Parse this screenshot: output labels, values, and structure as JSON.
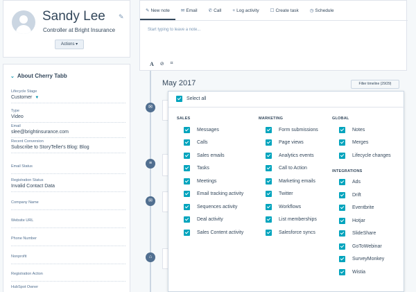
{
  "profile": {
    "name": "Sandy Lee",
    "title": "Controller at Bright Insurance",
    "actions_label": "Actions"
  },
  "about": {
    "header": "About Cherry Tabb",
    "properties": [
      {
        "label": "Lifecycle Stage",
        "value": "Customer",
        "dropdown": true
      },
      {
        "label": "Type",
        "value": "Video"
      },
      {
        "label": "Email",
        "value": "slee@brightinsurance.com"
      },
      {
        "label": "Recent Conversion",
        "value": "Subscribe to StoryTeller's Blog: Blog"
      },
      {
        "label": "Email Status",
        "value": ""
      },
      {
        "label": "Registration Status",
        "value": "Invalid Contact Data"
      },
      {
        "label": "Company Name",
        "value": ""
      },
      {
        "label": "Website URL",
        "value": ""
      },
      {
        "label": "Phone Number",
        "value": ""
      },
      {
        "label": "Nonprofit",
        "value": ""
      },
      {
        "label": "Registration Action",
        "value": ""
      },
      {
        "label": "HubSpot Owner",
        "value": ""
      }
    ]
  },
  "editor": {
    "tabs": [
      {
        "label": "New note",
        "icon": "pencil-icon",
        "glyph": "✎"
      },
      {
        "label": "Email",
        "icon": "email-icon",
        "glyph": "✉"
      },
      {
        "label": "Call",
        "icon": "phone-icon",
        "glyph": "✆"
      },
      {
        "label": "Log activity",
        "icon": "plus-icon",
        "glyph": "+"
      },
      {
        "label": "Create task",
        "icon": "task-icon",
        "glyph": "☐"
      },
      {
        "label": "Schedule",
        "icon": "clock-icon",
        "glyph": "◷"
      }
    ],
    "placeholder": "Start typing to leave a note...",
    "toolbar": {
      "bold": "A",
      "link": "🔗",
      "attach": "📎"
    }
  },
  "timeline": {
    "month": "May 2017",
    "filter_label": "Filter timeline (29/29)",
    "icons": [
      "✉",
      "≡",
      "✉",
      "⌂"
    ]
  },
  "filter": {
    "select_all": "Select all",
    "columns": [
      {
        "sections": [
          {
            "heading": "SALES",
            "items": [
              "Messages",
              "Calls",
              "Sales emails",
              "Tasks",
              "Meetings",
              "Email tracking activity",
              "Sequences activity",
              "Deal activity",
              "Sales Content activity"
            ]
          }
        ]
      },
      {
        "sections": [
          {
            "heading": "MARKETING",
            "items": [
              "Form submissions",
              "Page views",
              "Analytics events",
              "Call to Action",
              "Marketing emails",
              "Twitter",
              "Workflows",
              "List memberships",
              "Salesforce syncs"
            ]
          }
        ]
      },
      {
        "sections": [
          {
            "heading": "GLOBAL",
            "items": [
              "Notes",
              "Merges",
              "Lifecycle changes"
            ]
          },
          {
            "heading": "INTEGRATIONS",
            "items": [
              "Ads",
              "Drift",
              "Eventbrite",
              "Hotjar",
              "SlideShare",
              "GoToWebinar",
              "SurveyMonkey",
              "Wistia"
            ]
          }
        ]
      }
    ]
  }
}
